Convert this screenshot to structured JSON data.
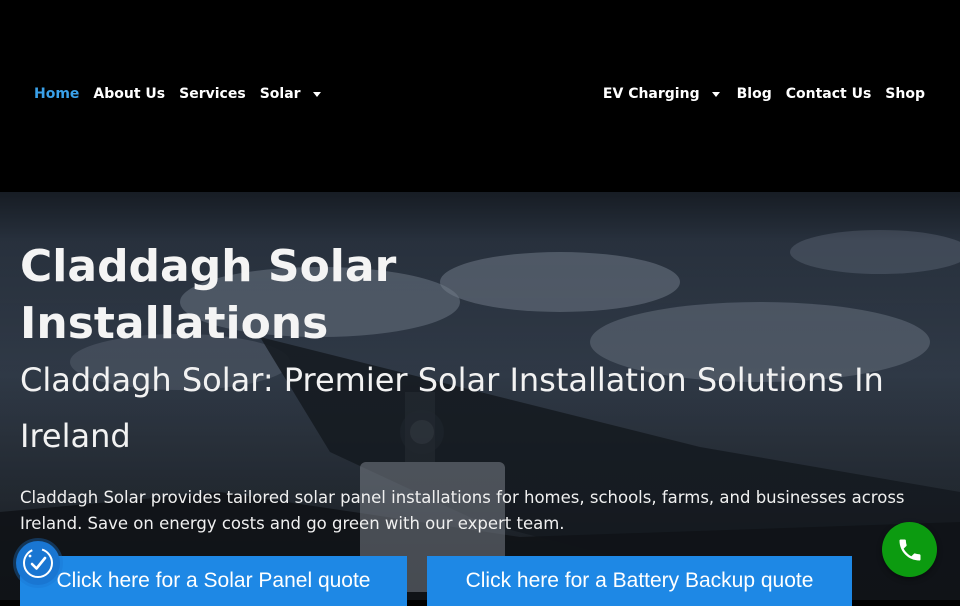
{
  "nav": {
    "left": [
      {
        "label": "Home",
        "active": true,
        "dropdown": false
      },
      {
        "label": "About Us",
        "active": false,
        "dropdown": false
      },
      {
        "label": "Services",
        "active": false,
        "dropdown": false
      },
      {
        "label": "Solar",
        "active": false,
        "dropdown": true
      }
    ],
    "right": [
      {
        "label": "EV Charging",
        "active": false,
        "dropdown": true
      },
      {
        "label": "Blog",
        "active": false,
        "dropdown": false
      },
      {
        "label": "Contact Us",
        "active": false,
        "dropdown": false
      },
      {
        "label": "Shop",
        "active": false,
        "dropdown": false
      }
    ]
  },
  "hero": {
    "title": "Claddagh Solar Installations",
    "subtitle": "Claddagh Solar: Premier Solar Installation Solutions In Ireland",
    "description": "Claddagh Solar provides tailored solar panel installations for homes, schools, farms, and businesses across Ireland. Save on energy costs and go green with our expert team.",
    "cta_solar": "Click here for a Solar Panel quote",
    "cta_battery": "Click here for a Battery Backup quote"
  },
  "widgets": {
    "accessibility_icon": "accessibility-icon",
    "call_icon": "phone-icon"
  },
  "colors": {
    "active_nav": "#3aa0e8",
    "cta_background": "#1e88e5",
    "call_button": "#0c9b10",
    "accessibility_button": "#1976d2"
  }
}
